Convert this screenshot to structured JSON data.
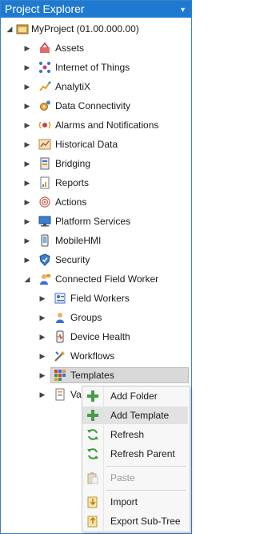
{
  "panel": {
    "title": "Project Explorer",
    "pin_icon": "dropdown-arrow-icon"
  },
  "tree": {
    "root": {
      "label": "MyProject (01.00.000.00)",
      "icon": "project-icon"
    },
    "items": [
      {
        "label": "Assets",
        "icon": "assets-icon"
      },
      {
        "label": "Internet of Things",
        "icon": "iot-icon"
      },
      {
        "label": "AnalytiX",
        "icon": "analytix-icon"
      },
      {
        "label": "Data Connectivity",
        "icon": "data-connectivity-icon"
      },
      {
        "label": "Alarms and Notifications",
        "icon": "alarm-icon"
      },
      {
        "label": "Historical Data",
        "icon": "historical-data-icon"
      },
      {
        "label": "Bridging",
        "icon": "bridging-icon"
      },
      {
        "label": "Reports",
        "icon": "reports-icon"
      },
      {
        "label": "Actions",
        "icon": "actions-icon"
      },
      {
        "label": "Platform Services",
        "icon": "platform-services-icon"
      },
      {
        "label": "MobileHMI",
        "icon": "mobilehmi-icon"
      },
      {
        "label": "Security",
        "icon": "security-icon"
      },
      {
        "label": "Connected Field Worker",
        "icon": "field-worker-icon"
      }
    ],
    "cfw_children": [
      {
        "label": "Field Workers",
        "icon": "field-workers-icon"
      },
      {
        "label": "Groups",
        "icon": "groups-icon"
      },
      {
        "label": "Device Health",
        "icon": "device-health-icon"
      },
      {
        "label": "Workflows",
        "icon": "workflows-icon"
      },
      {
        "label": "Templates",
        "icon": "templates-icon"
      },
      {
        "label": "Va",
        "icon": "variables-icon"
      }
    ]
  },
  "context_menu": {
    "items": [
      {
        "label": "Add Folder",
        "icon": "add-icon"
      },
      {
        "label": "Add Template",
        "icon": "add-icon"
      },
      {
        "label": "Refresh",
        "icon": "refresh-icon"
      },
      {
        "label": "Refresh Parent",
        "icon": "refresh-icon"
      },
      {
        "label": "Paste",
        "icon": "paste-icon"
      },
      {
        "label": "Import",
        "icon": "import-icon"
      },
      {
        "label": "Export Sub-Tree",
        "icon": "export-icon"
      }
    ]
  }
}
